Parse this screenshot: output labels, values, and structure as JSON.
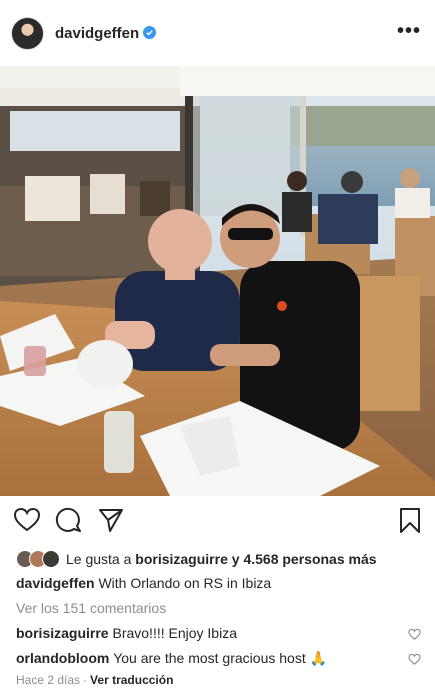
{
  "post": {
    "username": "davidgeffen",
    "more_icon": "more-horizontal-icon",
    "liked_by_prefix": "Le gusta a",
    "liked_by_user": "borisizaguirre",
    "liked_by_suffix": "y 4.568 personas más",
    "caption_user": "davidgeffen",
    "caption_text": "With Orlando on RS in Ibiza",
    "view_comments": "Ver los 151 comentarios",
    "comments": [
      {
        "user": "borisizaguirre",
        "text": "Bravo!!!! Enjoy Ibiza"
      },
      {
        "user": "orlandobloom",
        "text": "You are the most gracious host 🙏"
      }
    ],
    "time_ago": "Hace 2 días",
    "separator": "·",
    "translate": "Ver traducción"
  },
  "colors": {
    "text": "#262626",
    "secondary": "#8e8e8e",
    "verified": "#3897f0"
  }
}
